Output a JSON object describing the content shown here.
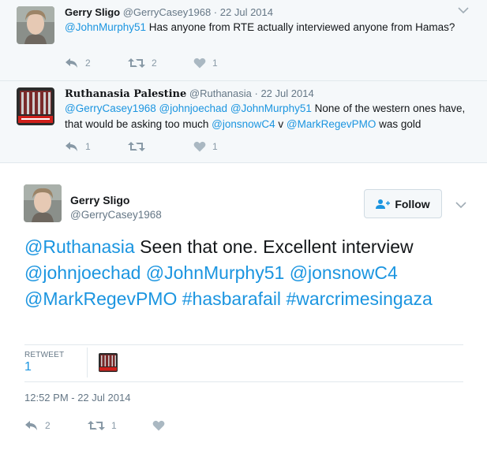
{
  "replies": [
    {
      "name": "Gerry Sligo",
      "handle": "@GerryCasey1968",
      "dot": "·",
      "date": "22 Jul 2014",
      "text_parts": [
        {
          "t": "@JohnMurphy51",
          "mention": true
        },
        {
          "t": " Has anyone from RTE actually interviewed anyone from Hamas?",
          "mention": false
        }
      ],
      "reply_count": "2",
      "retweet_count": "2",
      "like_count": "1"
    },
    {
      "name": "Ruthanasia Palestine",
      "handle": "@Ruthanasia",
      "dot": "·",
      "date": "22 Jul 2014",
      "text_parts": [
        {
          "t": "@GerryCasey1968",
          "mention": true
        },
        {
          "t": " ",
          "mention": false
        },
        {
          "t": "@johnjoechad",
          "mention": true
        },
        {
          "t": " ",
          "mention": false
        },
        {
          "t": "@JohnMurphy51",
          "mention": true
        },
        {
          "t": " None of the western ones have, that would be asking too much ",
          "mention": false
        },
        {
          "t": "@jonsnowC4",
          "mention": true
        },
        {
          "t": " v ",
          "mention": false
        },
        {
          "t": "@MarkRegevPMO",
          "mention": true
        },
        {
          "t": " was gold",
          "mention": false
        }
      ],
      "reply_count": "1",
      "retweet_count": "",
      "like_count": "1"
    }
  ],
  "main": {
    "name": "Gerry Sligo",
    "handle": "@GerryCasey1968",
    "follow_label": "Follow",
    "text_parts": [
      {
        "t": "@Ruthanasia",
        "mention": true
      },
      {
        "t": " Seen that one. Excellent interview ",
        "mention": false
      },
      {
        "t": "@johnjoechad",
        "mention": true
      },
      {
        "t": " ",
        "mention": false
      },
      {
        "t": "@JohnMurphy51",
        "mention": true
      },
      {
        "t": " ",
        "mention": false
      },
      {
        "t": "@jonsnowC4",
        "mention": true
      },
      {
        "t": " ",
        "mention": false
      },
      {
        "t": "@MarkRegevPMO",
        "mention": true
      },
      {
        "t": " ",
        "mention": false
      },
      {
        "t": "#hasbarafail",
        "mention": true
      },
      {
        "t": " ",
        "mention": false
      },
      {
        "t": "#warcrimesingaza",
        "mention": true
      }
    ],
    "retweet_label": "RETWEET",
    "retweet_count": "1",
    "timestamp": "12:52 PM - 22 Jul 2014",
    "reply_count": "2",
    "retweet_action_count": "1",
    "like_count": ""
  },
  "colors": {
    "link": "#1b95e0",
    "muted": "#657786",
    "reply_bg": "#f5f8fa"
  },
  "icons": [
    "reply-icon",
    "retweet-icon",
    "heart-icon",
    "chevron-down-icon",
    "follow-person-icon"
  ]
}
